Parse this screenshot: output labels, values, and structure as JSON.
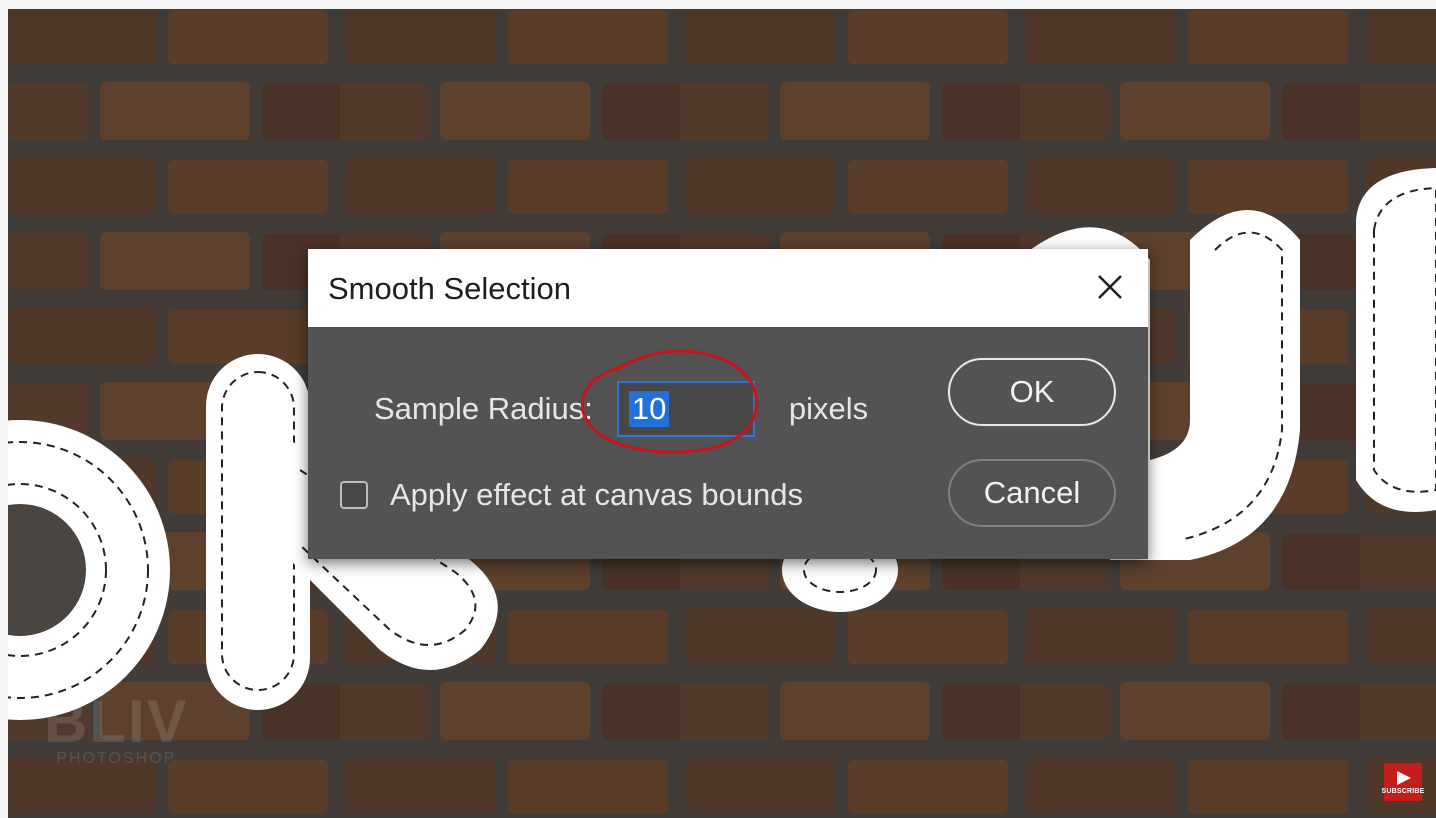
{
  "dialog": {
    "title": "Smooth Selection",
    "sample_radius_label": "Sample Radius:",
    "sample_radius_value": "10",
    "units_label": "pixels",
    "canvas_bounds_label": "Apply effect at canvas bounds",
    "canvas_bounds_checked": false,
    "ok_label": "OK",
    "cancel_label": "Cancel"
  },
  "overlay": {
    "watermark_text": "BLIV",
    "watermark_subtext": "PHOTOSHOP",
    "subscribe_label": "SUBSCRIBE"
  },
  "colors": {
    "annotation_circle": "#c8141c",
    "input_highlight": "#2271d9",
    "dialog_body": "#535353",
    "subscribe_red": "#c51d1a"
  },
  "icons": {
    "close": "close-icon",
    "subscribe": "play-icon"
  }
}
